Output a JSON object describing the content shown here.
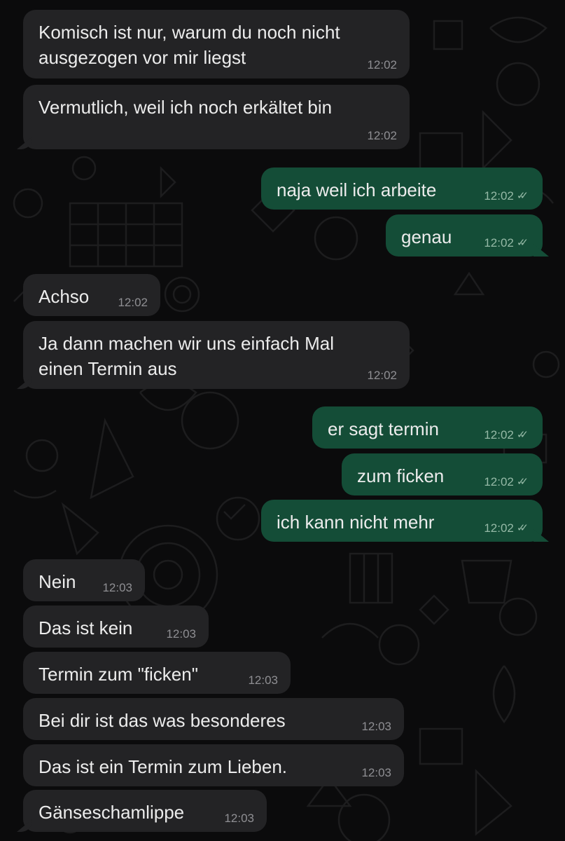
{
  "colors": {
    "background": "#0b0b0c",
    "incoming_bubble": "#232325",
    "outgoing_bubble": "#144d37",
    "text": "#ececec",
    "timestamp": "#8f8f93"
  },
  "messages": [
    {
      "direction": "incoming",
      "text": "Komisch ist nur, warum du noch nicht\nausgezogen vor mir liegst",
      "time": "12:02"
    },
    {
      "direction": "incoming",
      "text": "Vermutlich, weil ich noch erkältet bin",
      "time": "12:02"
    },
    {
      "direction": "outgoing",
      "text": "naja weil ich arbeite",
      "time": "12:02",
      "status_icon": "double-check-icon"
    },
    {
      "direction": "outgoing",
      "text": "genau",
      "time": "12:02",
      "status_icon": "double-check-icon"
    },
    {
      "direction": "incoming",
      "text": "Achso",
      "time": "12:02"
    },
    {
      "direction": "incoming",
      "text": "Ja dann machen wir uns einfach Mal\neinen Termin aus",
      "time": "12:02"
    },
    {
      "direction": "outgoing",
      "text": "er sagt termin",
      "time": "12:02",
      "status_icon": "double-check-icon"
    },
    {
      "direction": "outgoing",
      "text": "zum ficken",
      "time": "12:02",
      "status_icon": "double-check-icon"
    },
    {
      "direction": "outgoing",
      "text": "ich kann nicht mehr",
      "time": "12:02",
      "status_icon": "double-check-icon"
    },
    {
      "direction": "incoming",
      "text": "Nein",
      "time": "12:03"
    },
    {
      "direction": "incoming",
      "text": "Das ist kein",
      "time": "12:03"
    },
    {
      "direction": "incoming",
      "text": "Termin zum \"ficken\"",
      "time": "12:03"
    },
    {
      "direction": "incoming",
      "text": "Bei dir ist das was besonderes",
      "time": "12:03"
    },
    {
      "direction": "incoming",
      "text": "Das ist ein Termin zum Lieben.",
      "time": "12:03"
    },
    {
      "direction": "incoming",
      "text": "Gänseschamlippe",
      "time": "12:03"
    }
  ]
}
